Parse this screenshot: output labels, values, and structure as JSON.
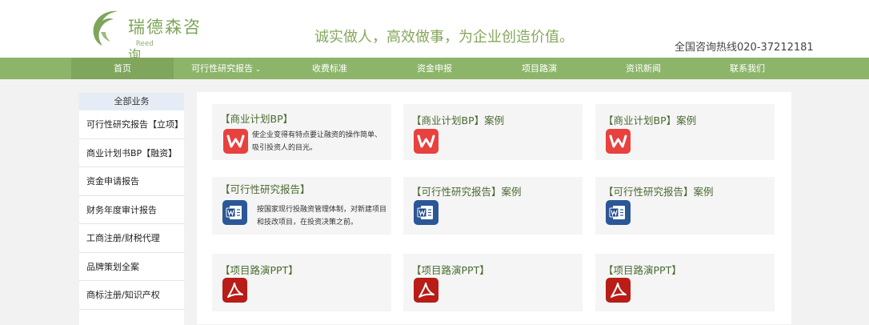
{
  "header": {
    "brand_name": "瑞德森咨",
    "brand_sub": "Reed",
    "brand_cut": "询",
    "slogan": "诚实做人，高效做事，为企业创造价值。",
    "hotline": "全国咨询热线020-37212181"
  },
  "nav": {
    "items": [
      {
        "label": "首页"
      },
      {
        "label": "可行性研究报告"
      },
      {
        "label": "收费标准"
      },
      {
        "label": "资金申报"
      },
      {
        "label": "项目路演"
      },
      {
        "label": "资讯新闻"
      },
      {
        "label": "联系我们"
      }
    ]
  },
  "sidebar": {
    "heading": "全部业务",
    "items": [
      {
        "label": "可行性研究报告【立项】"
      },
      {
        "label": "商业计划书BP【融资】"
      },
      {
        "label": "资金申请报告"
      },
      {
        "label": "财务年度审计报告"
      },
      {
        "label": "工商注册/财税代理"
      },
      {
        "label": "品牌策划全案"
      },
      {
        "label": "商标注册/知识产权"
      }
    ]
  },
  "cards": [
    {
      "title": "【商业计划BP】",
      "desc": "使企业变得有特点要让融资的操作简单、吸引投资人的目光。",
      "icon": "wps-icon"
    },
    {
      "title": "【商业计划BP】案例",
      "icon": "wps-icon"
    },
    {
      "title": "【商业计划BP】案例",
      "icon": "wps-icon"
    },
    {
      "title": "【可行性研究报告】",
      "desc": "按国家现行投融资管理体制，对新建项目和技改项目，在投资决策之前。",
      "icon": "word-icon"
    },
    {
      "title": "【可行性研究报告】案例",
      "icon": "word-icon"
    },
    {
      "title": "【可行性研究报告】案例",
      "icon": "word-icon"
    },
    {
      "title": "【项目路演PPT】",
      "icon": "pdf-icon"
    },
    {
      "title": "【项目路演PPT】",
      "icon": "pdf-icon"
    },
    {
      "title": "【项目路演PPT】",
      "icon": "pdf-icon"
    }
  ],
  "colors": {
    "nav_bg": "#8db56a",
    "brand_green": "#7fa55b",
    "wps_red": "#e8413e",
    "word_blue": "#2b5797",
    "pdf_red": "#b81d18"
  }
}
